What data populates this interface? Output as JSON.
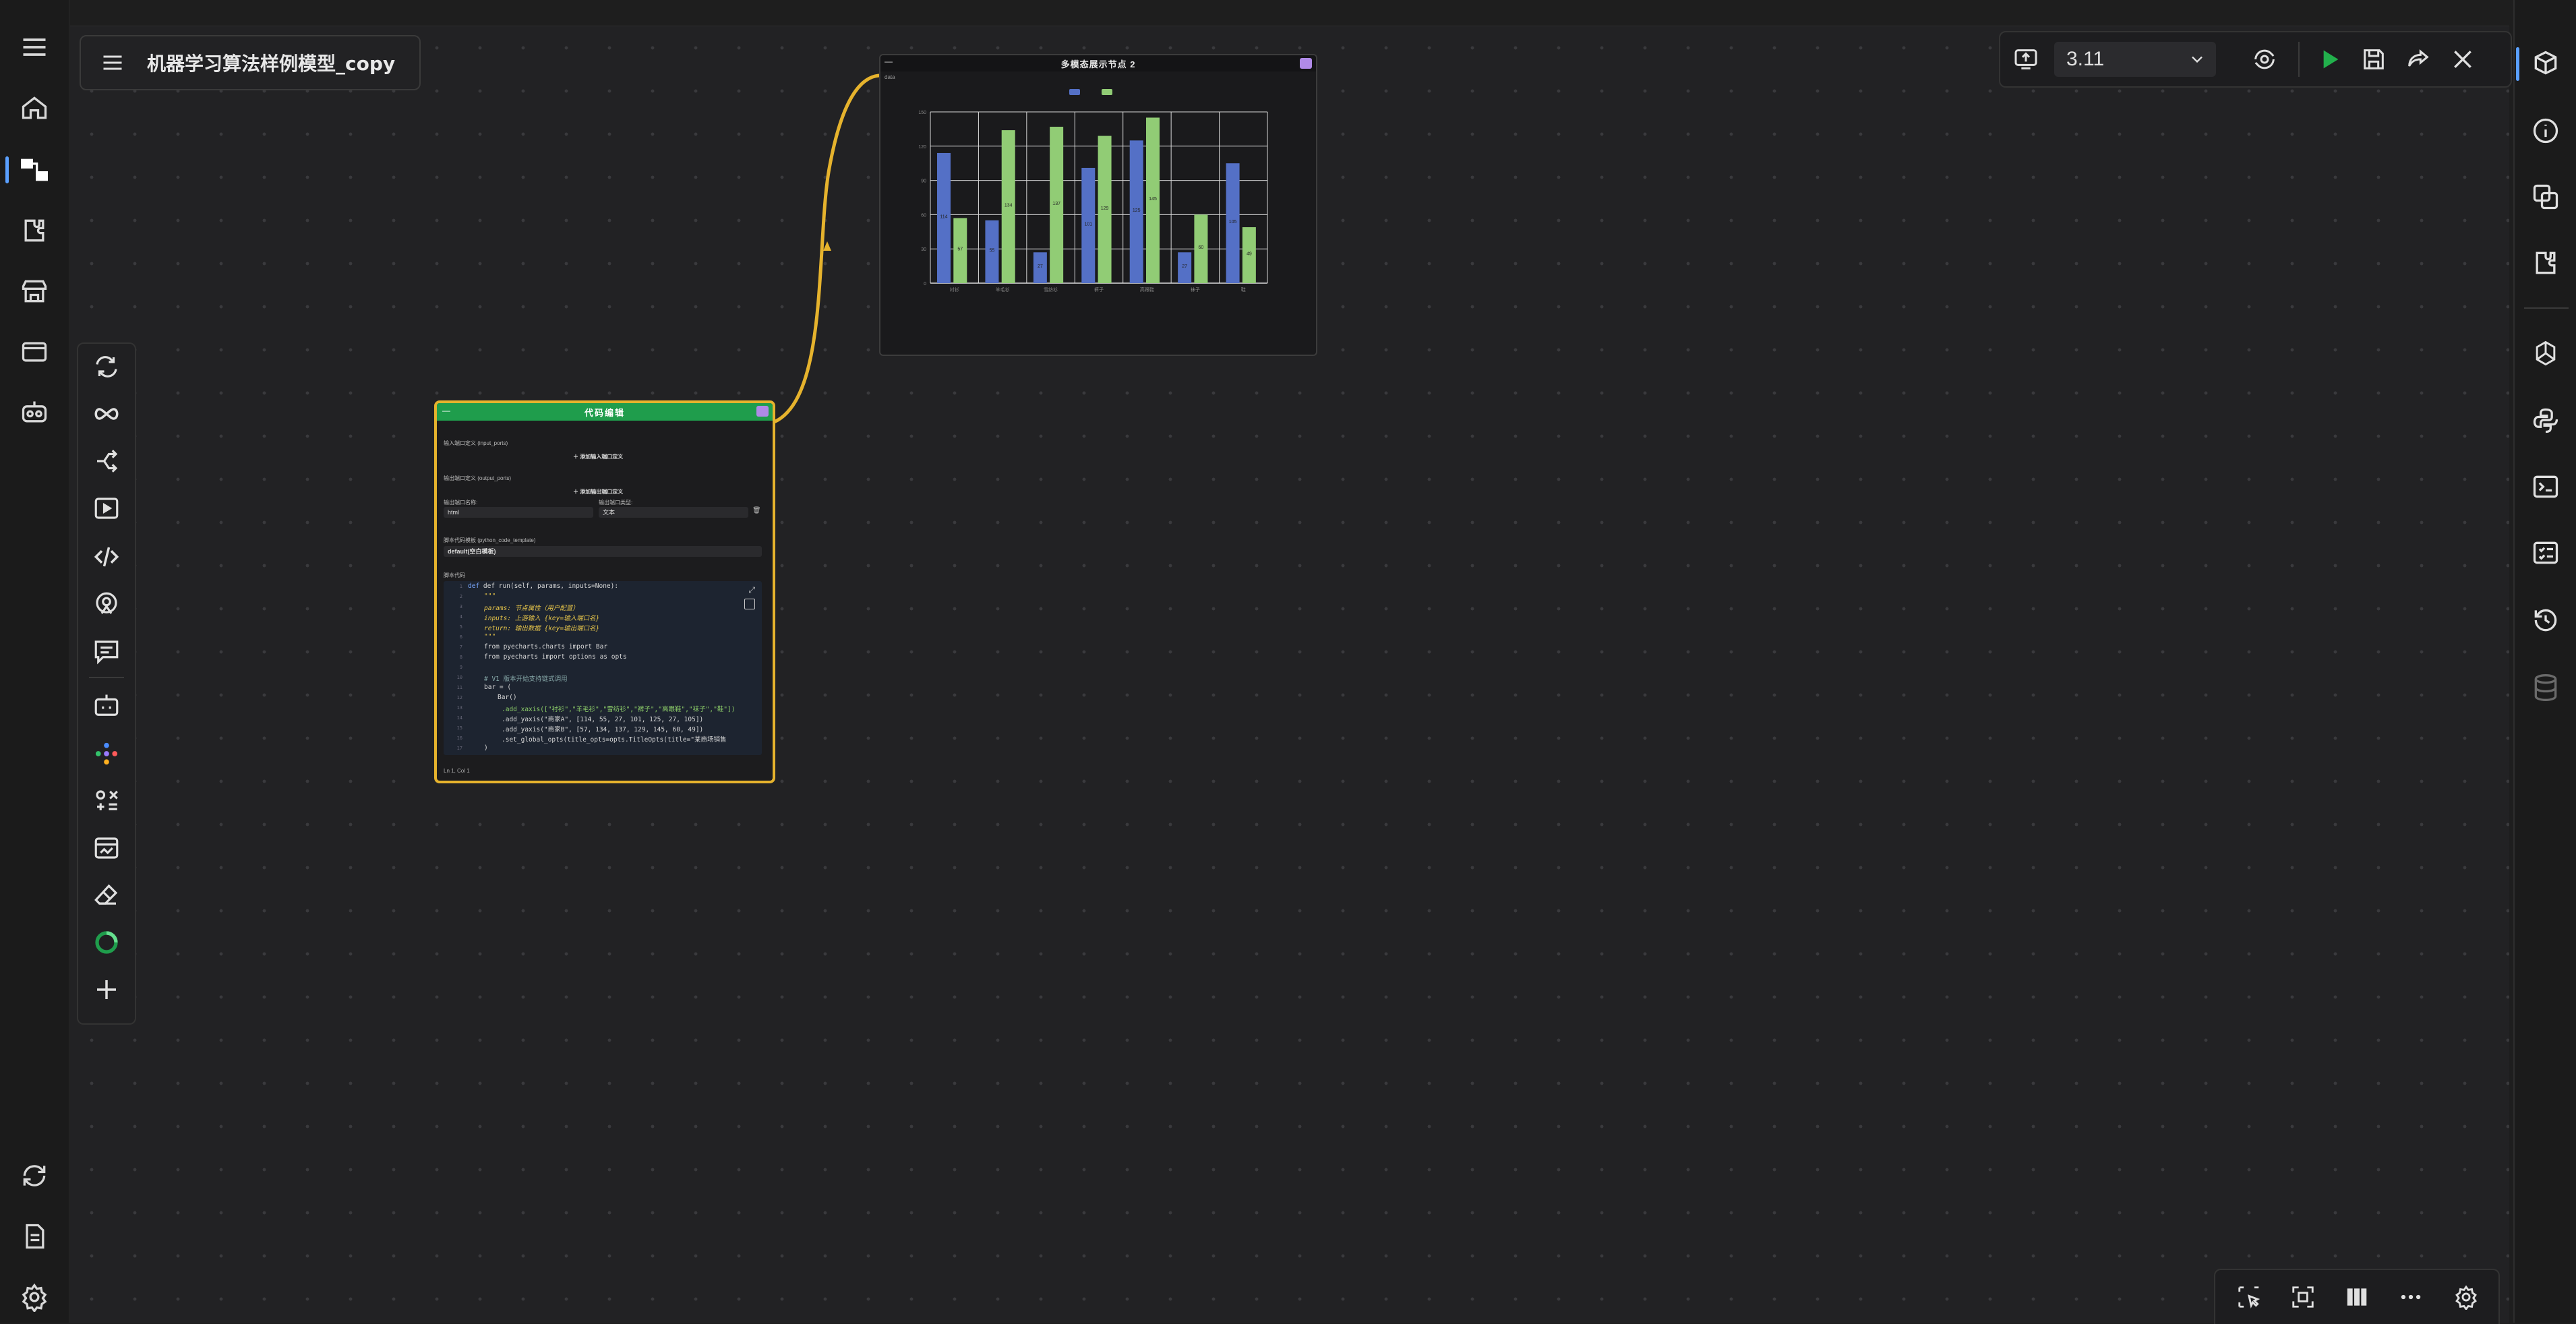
{
  "workflow": {
    "title": "机器学习算法样例模型_copy"
  },
  "toolbar": {
    "version": "3.11"
  },
  "chart_node": {
    "title": "多模态展示节点 2",
    "port_label": "data"
  },
  "chart_data": {
    "type": "bar",
    "title": "",
    "categories": [
      "衬衫",
      "羊毛衫",
      "雪纺衫",
      "裤子",
      "高跟鞋",
      "袜子",
      "鞋"
    ],
    "series": [
      {
        "name": "",
        "color": "#5470c6",
        "values": [
          114,
          55,
          27,
          101,
          125,
          27,
          105
        ]
      },
      {
        "name": "",
        "color": "#91cc75",
        "values": [
          57,
          134,
          137,
          129,
          145,
          60,
          49
        ]
      }
    ],
    "ylim": [
      0,
      150
    ],
    "grid": true,
    "legend": "top-center"
  },
  "code_node": {
    "title": "代码编辑",
    "input_ports_label": "输入端口定义 (input_ports)",
    "add_input_label": "添加输入端口定义",
    "output_ports_label": "输出端口定义 (output_ports)",
    "add_output_label": "添加输出端口定义",
    "output_name_label": "输出端口名称:",
    "output_name_value": "html",
    "output_type_label": "输出端口类型:",
    "output_type_value": "文本",
    "template_label": "脚本代码模板 (python_code_template)",
    "template_value": "default(空白模板)",
    "code_label": "脚本代码",
    "status": "Ln 1, Col 1",
    "code": {
      "l1": "def run(self, params, inputs=None):",
      "l2": "\"\"\"",
      "l3": "params: 节点属性（用户配置）",
      "l4": "inputs: 上游输入 {key=输入端口名}",
      "l5": "return: 输出数据 {key=输出端口名}",
      "l6": "\"\"\"",
      "l7": "from pyecharts.charts import Bar",
      "l8": "from pyecharts import options as opts",
      "l9": "",
      "l10": "# V1 版本开始支持链式调用",
      "l11": "bar = (",
      "l12": "Bar()",
      "l13": ".add_xaxis([\"衬衫\",\"羊毛衫\",\"雪纺衫\",\"裤子\",\"高跟鞋\",\"袜子\",\"鞋\"])",
      "l14": ".add_yaxis(\"商家A\", [114, 55, 27, 101, 125, 27, 105])",
      "l15": ".add_yaxis(\"商家B\", [57, 134, 137, 129, 145, 60, 49])",
      "l16": ".set_global_opts(title_opts=opts.TitleOpts(title=\"某商场销售",
      "l17": ")"
    }
  }
}
